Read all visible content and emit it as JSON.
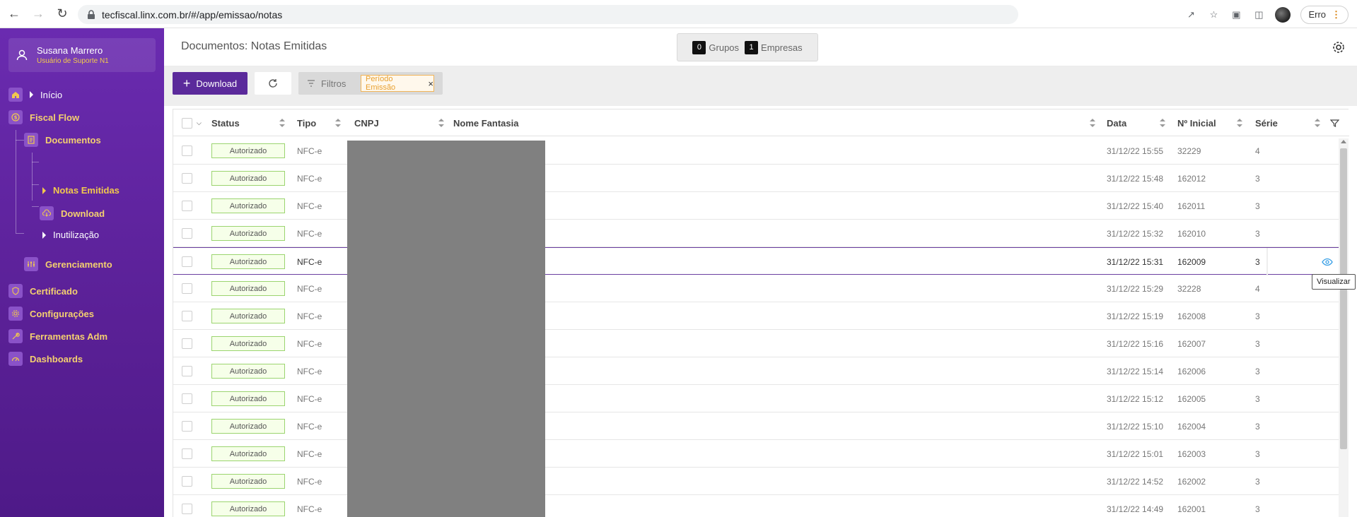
{
  "browser": {
    "url": "tecfiscal.linx.com.br/#/app/emissao/notas",
    "profile_status": "Erro"
  },
  "sidebar": {
    "user": {
      "name": "Susana Marrero",
      "role": "Usuário de Suporte N1"
    },
    "items": [
      {
        "label": "Início"
      },
      {
        "label": "Fiscal Flow"
      },
      {
        "label": "Documentos"
      },
      {
        "label": "Notas Emitidas"
      },
      {
        "label": "Download"
      },
      {
        "label": "Inutilização"
      },
      {
        "label": "Gerenciamento"
      },
      {
        "label": "Certificado"
      },
      {
        "label": "Configurações"
      },
      {
        "label": "Ferramentas Adm"
      },
      {
        "label": "Dashboards"
      }
    ],
    "accent_color": "#f2c94c"
  },
  "header": {
    "title": "Documentos: Notas Emitidas",
    "grupos_count": "0",
    "grupos_label": "Grupos",
    "empresas_count": "1",
    "empresas_label": "Empresas"
  },
  "toolbar": {
    "download_label": "Download",
    "filters_label": "Filtros",
    "filter_tag": "Período Emissão"
  },
  "table": {
    "columns": [
      "Status",
      "Tipo",
      "CNPJ",
      "Nome Fantasia",
      "Data",
      "Nº Inicial",
      "Série"
    ],
    "rows": [
      {
        "status": "Autorizado",
        "tipo": "NFC-e",
        "data": "31/12/22 15:55",
        "numero": "32229",
        "serie": "4"
      },
      {
        "status": "Autorizado",
        "tipo": "NFC-e",
        "data": "31/12/22 15:48",
        "numero": "162012",
        "serie": "3"
      },
      {
        "status": "Autorizado",
        "tipo": "NFC-e",
        "data": "31/12/22 15:40",
        "numero": "162011",
        "serie": "3"
      },
      {
        "status": "Autorizado",
        "tipo": "NFC-e",
        "data": "31/12/22 15:32",
        "numero": "162010",
        "serie": "3"
      },
      {
        "status": "Autorizado",
        "tipo": "NFC-e",
        "data": "31/12/22 15:31",
        "numero": "162009",
        "serie": "3"
      },
      {
        "status": "Autorizado",
        "tipo": "NFC-e",
        "data": "31/12/22 15:29",
        "numero": "32228",
        "serie": "4"
      },
      {
        "status": "Autorizado",
        "tipo": "NFC-e",
        "data": "31/12/22 15:19",
        "numero": "162008",
        "serie": "3"
      },
      {
        "status": "Autorizado",
        "tipo": "NFC-e",
        "data": "31/12/22 15:16",
        "numero": "162007",
        "serie": "3"
      },
      {
        "status": "Autorizado",
        "tipo": "NFC-e",
        "data": "31/12/22 15:14",
        "numero": "162006",
        "serie": "3"
      },
      {
        "status": "Autorizado",
        "tipo": "NFC-e",
        "data": "31/12/22 15:12",
        "numero": "162005",
        "serie": "3"
      },
      {
        "status": "Autorizado",
        "tipo": "NFC-e",
        "data": "31/12/22 15:10",
        "numero": "162004",
        "serie": "3"
      },
      {
        "status": "Autorizado",
        "tipo": "NFC-e",
        "data": "31/12/22 15:01",
        "numero": "162003",
        "serie": "3"
      },
      {
        "status": "Autorizado",
        "tipo": "NFC-e",
        "data": "31/12/22 14:52",
        "numero": "162002",
        "serie": "3"
      },
      {
        "status": "Autorizado",
        "tipo": "NFC-e",
        "data": "31/12/22 14:49",
        "numero": "162001",
        "serie": "3"
      }
    ],
    "selected_row": 4,
    "tooltip": "Visualizar"
  }
}
